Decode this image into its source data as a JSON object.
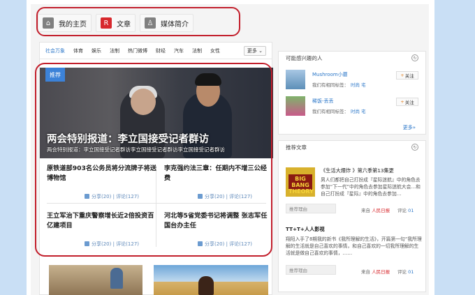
{
  "topnav": {
    "items": [
      {
        "label": "我的主页",
        "icon": "home-icon"
      },
      {
        "label": "文章",
        "icon": "article-icon"
      },
      {
        "label": "媒体简介",
        "icon": "media-profile-icon"
      }
    ]
  },
  "categories": {
    "items": [
      "社会万象",
      "体育",
      "娱乐",
      "法制",
      "热门微博",
      "财经",
      "汽车",
      "法制",
      "女性"
    ],
    "more": "更多"
  },
  "feature": {
    "tag": "推荐",
    "title": "两会特别报道：李立国接受记者群访",
    "subtitle": "两会特别报道：李立国接受记者群访李立国接受记者群访李立国接受记者群访"
  },
  "news": [
    {
      "title": "原铁道部903名公务员将分流牌子将送博物馆",
      "share": "分享(20)",
      "comment": "评论(127)"
    },
    {
      "title": "李克强约法三章：任期内不增三公经费",
      "share": "分享(20)",
      "comment": "评论(127)"
    },
    {
      "title": "王立军治下重庆警察增长近2倍投资百亿建项目",
      "share": "分享(20)",
      "comment": "评论(127)"
    },
    {
      "title": "河北等5省党委书记将调整 张志军任国台办主任",
      "share": "分享(20)",
      "comment": "评论(127)"
    }
  ],
  "people": {
    "title": "可能感兴趣的人",
    "users": [
      {
        "name": "Mushroom小蘑",
        "tags_prefix": "我们有相同标签：",
        "tags": "时尚 宅",
        "follow": "关注"
      },
      {
        "name": "稀饭-丢丢",
        "tags_prefix": "我们有相同标签：",
        "tags": "时尚 宅",
        "follow": "关注"
      }
    ],
    "more": "更多»"
  },
  "articles": {
    "title": "推荐文章",
    "items": [
      {
        "cover": "BIG BANG THEORY",
        "title": "《生活大爆炸 》第六季第13集更",
        "body": "男人们都把自己打扮成『星际迷航』中的角色去参加“下一代”中的角色去参加星际迷航大会…和自己打扮成『星际』中的角色去参加…",
        "reason": "推荐理由",
        "source_prefix": "来自",
        "source": "人民日报",
        "comment_prefix": "评论",
        "comment_count": "01"
      },
      {
        "title": "TT+T+人人影视",
        "body": "翔阳入手了8期我的新书《我所理解的生活》，开篇第一句“我所理解的生活就是自己喜欢的事情，和自己喜欢的一切我所理解的生活就是做自己喜欢的事情，……",
        "reason": "推荐理由",
        "source_prefix": "来自",
        "source": "人民日报",
        "comment_prefix": "评论",
        "comment_count": "01"
      }
    ]
  }
}
